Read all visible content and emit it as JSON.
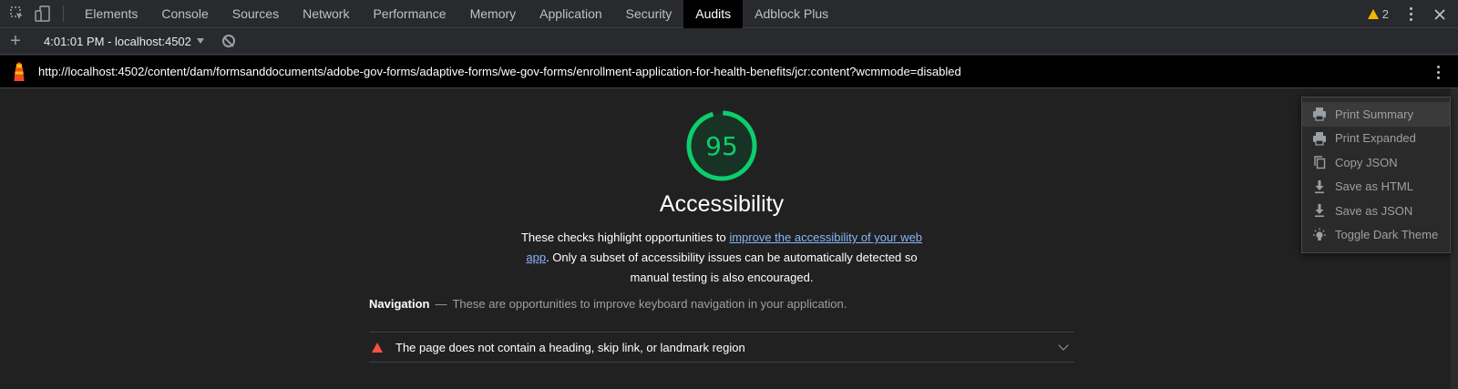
{
  "devtools": {
    "tabs": [
      {
        "label": "Elements"
      },
      {
        "label": "Console"
      },
      {
        "label": "Sources"
      },
      {
        "label": "Network"
      },
      {
        "label": "Performance"
      },
      {
        "label": "Memory"
      },
      {
        "label": "Application"
      },
      {
        "label": "Security"
      },
      {
        "label": "Audits",
        "active": true
      },
      {
        "label": "Adblock Plus"
      }
    ],
    "warning_count": "2",
    "icons": {
      "inspect": "inspect-element-icon",
      "device": "device-toolbar-icon",
      "warning": "warning-icon",
      "more": "more-options-icon",
      "close": "close-icon"
    }
  },
  "toolbar": {
    "new_audit": "+",
    "report_selector": "4:01:01 PM - localhost:4502"
  },
  "report": {
    "url": "http://localhost:4502/content/dam/formsanddocuments/adobe-gov-forms/adaptive-forms/we-gov-forms/enrollment-application-for-health-benefits/jcr:content?wcmmode=disabled",
    "category": {
      "score": "95",
      "score_fraction": 0.95,
      "title": "Accessibility",
      "description_before": "These checks highlight opportunities to ",
      "description_link": "improve the accessibility of your web app",
      "description_after": ". Only a subset of accessibility issues can be automatically detected so manual testing is also encouraged."
    },
    "group": {
      "title": "Navigation",
      "separator": "—",
      "description": "These are opportunities to improve keyboard navigation in your application."
    },
    "audits": [
      {
        "title": "The page does not contain a heading, skip link, or landmark region",
        "status": "fail"
      }
    ]
  },
  "menu": {
    "items": [
      {
        "label": "Print Summary",
        "icon": "print-icon"
      },
      {
        "label": "Print Expanded",
        "icon": "print-icon"
      },
      {
        "label": "Copy JSON",
        "icon": "copy-icon"
      },
      {
        "label": "Save as HTML",
        "icon": "download-icon"
      },
      {
        "label": "Save as JSON",
        "icon": "download-icon"
      },
      {
        "label": "Toggle Dark Theme",
        "icon": "lightbulb-icon"
      }
    ]
  },
  "colors": {
    "pass": "#0cce6b",
    "fail": "#ff4e42",
    "warning": "#f2b600",
    "link": "#8ab4f8"
  }
}
